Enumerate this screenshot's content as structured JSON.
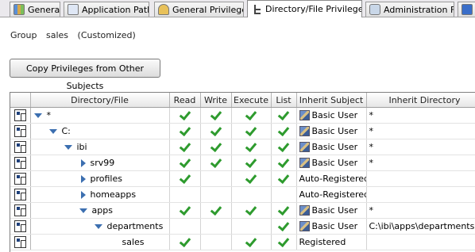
{
  "tabs": [
    {
      "label": "General",
      "icon": "general-icon",
      "active": false
    },
    {
      "label": "Application Path",
      "icon": "application-path-icon",
      "active": false
    },
    {
      "label": "General Privileges",
      "icon": "lock-icon",
      "active": false
    },
    {
      "label": "Directory/File Privileges",
      "icon": "directory-tree-icon",
      "active": true
    },
    {
      "label": "Administration File",
      "icon": "admin-file-icon",
      "active": false
    }
  ],
  "group": {
    "label": "Group",
    "name": "sales",
    "status": "(Customized)"
  },
  "copy_button": "Copy Privileges from Other Subjects",
  "table": {
    "headers": [
      "Directory/File",
      "Read",
      "Write",
      "Execute",
      "List",
      "Inherit Subject",
      "Inherit Directory"
    ],
    "rows": [
      {
        "name": "*",
        "expander": "down",
        "level": 0,
        "read": true,
        "write": true,
        "execute": true,
        "list": true,
        "subject": "Basic User",
        "subject_icon": true,
        "directory": "*"
      },
      {
        "name": "C:",
        "expander": "down",
        "level": 1,
        "read": true,
        "write": true,
        "execute": true,
        "list": true,
        "subject": "Basic User",
        "subject_icon": true,
        "directory": "*"
      },
      {
        "name": "ibi",
        "expander": "down",
        "level": 2,
        "read": true,
        "write": true,
        "execute": true,
        "list": true,
        "subject": "Basic User",
        "subject_icon": true,
        "directory": "*"
      },
      {
        "name": "srv99",
        "expander": "right",
        "level": 3,
        "read": true,
        "write": true,
        "execute": true,
        "list": true,
        "subject": "Basic User",
        "subject_icon": true,
        "directory": "*"
      },
      {
        "name": "profiles",
        "expander": "right",
        "level": 3,
        "read": true,
        "write": false,
        "execute": true,
        "list": true,
        "subject": "Auto-Registered",
        "subject_icon": false,
        "directory": ""
      },
      {
        "name": "homeapps",
        "expander": "right",
        "level": 3,
        "read": false,
        "write": false,
        "execute": false,
        "list": false,
        "subject": "Auto-Registered",
        "subject_icon": false,
        "directory": ""
      },
      {
        "name": "apps",
        "expander": "down",
        "level": 3,
        "read": true,
        "write": true,
        "execute": true,
        "list": true,
        "subject": "Basic User",
        "subject_icon": true,
        "directory": "*"
      },
      {
        "name": "departments",
        "expander": "down",
        "level": 4,
        "read": false,
        "write": false,
        "execute": false,
        "list": true,
        "subject": "Basic User",
        "subject_icon": true,
        "directory": "C:\\ibi\\apps\\departments"
      },
      {
        "name": "sales",
        "expander": "none",
        "level": 5,
        "read": true,
        "write": false,
        "execute": true,
        "list": true,
        "subject": "Registered",
        "subject_icon": false,
        "directory": ""
      }
    ]
  },
  "colors": {
    "check": "#2e9b2e",
    "expander": "#3c6fb0",
    "tab_bar": "#ebe9ed"
  }
}
